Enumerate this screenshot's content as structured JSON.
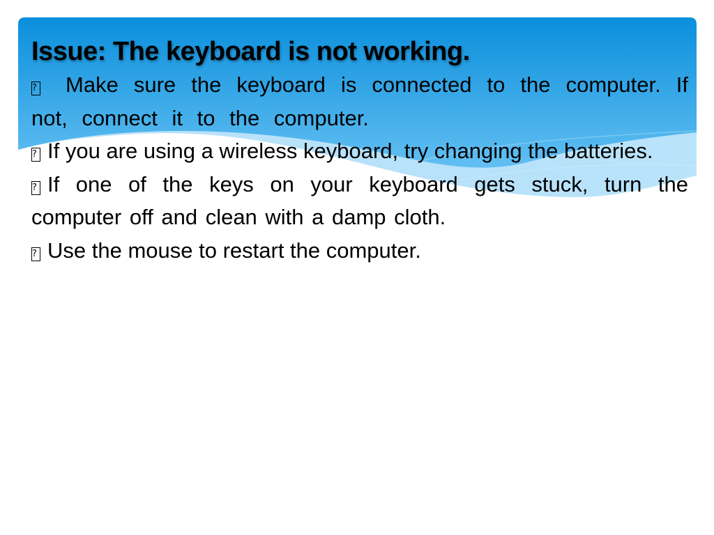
{
  "slide": {
    "title": "Issue: The keyboard is not working.",
    "bullet_marker": "?",
    "bullets": [
      "Make sure the keyboard is connected to the computer. If not, connect it to the computer.",
      "If you are using a wireless keyboard, try changing the batteries.",
      "If one of the keys on your keyboard gets stuck, turn the computer off and clean with a damp cloth.",
      "Use the mouse to restart the computer."
    ]
  },
  "theme": {
    "banner_top_color": "#0a8fdc",
    "banner_bottom_color": "#5dbbf0",
    "wave_light_color": "#a9dcf8",
    "text_color": "#000000",
    "background_color": "#ffffff"
  }
}
